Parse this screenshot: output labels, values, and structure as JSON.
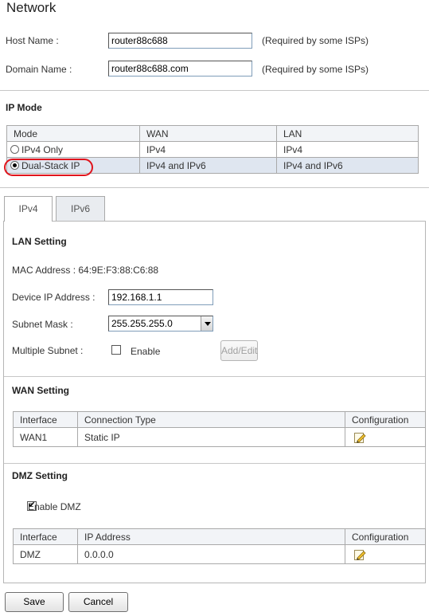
{
  "page": {
    "title": "Network"
  },
  "host": {
    "label": "Host Name :",
    "value": "router88c688",
    "note": "(Required by some ISPs)"
  },
  "domain": {
    "label": "Domain Name :",
    "value": "router88c688.com",
    "note": "(Required by some ISPs)"
  },
  "ip_mode": {
    "heading": "IP Mode",
    "headers": [
      "Mode",
      "WAN",
      "LAN"
    ],
    "rows": [
      {
        "mode": "IPv4 Only",
        "wan": "IPv4",
        "lan": "IPv4",
        "selected": false
      },
      {
        "mode": "Dual-Stack IP",
        "wan": "IPv4 and IPv6",
        "lan": "IPv4 and IPv6",
        "selected": true
      }
    ]
  },
  "tabs": [
    {
      "label": "IPv4",
      "active": true
    },
    {
      "label": "IPv6",
      "active": false
    }
  ],
  "lan": {
    "heading": "LAN Setting",
    "mac_label": "MAC Address :",
    "mac_value": "64:9E:F3:88:C6:88",
    "device_ip_label": "Device IP Address :",
    "device_ip_value": "192.168.1.1",
    "subnet_label": "Subnet Mask :",
    "subnet_value": "255.255.255.0",
    "multiple_subnet_label": "Multiple Subnet  :",
    "enable_label": "Enable",
    "enable_checked": false,
    "add_edit_label": "Add/Edit"
  },
  "wan": {
    "heading": "WAN Setting",
    "headers": [
      "Interface",
      "Connection Type",
      "Configuration"
    ],
    "rows": [
      {
        "interface": "WAN1",
        "type": "Static IP"
      }
    ]
  },
  "dmz": {
    "heading": "DMZ Setting",
    "enable_label": "Enable DMZ",
    "enable_checked": true,
    "headers": [
      "Interface",
      "IP Address",
      "Configuration"
    ],
    "rows": [
      {
        "interface": "DMZ",
        "ip": "0.0.0.0"
      }
    ]
  },
  "buttons": {
    "save": "Save",
    "cancel": "Cancel"
  },
  "icons": {
    "edit": "edit-pencil-icon",
    "radio": "radio-icon",
    "checkbox": "checkbox-icon",
    "dropdown": "chevron-down-icon"
  },
  "colors": {
    "highlight": "#e0141c",
    "stripe": "#dfe6f0",
    "header": "#f2f4f7"
  }
}
